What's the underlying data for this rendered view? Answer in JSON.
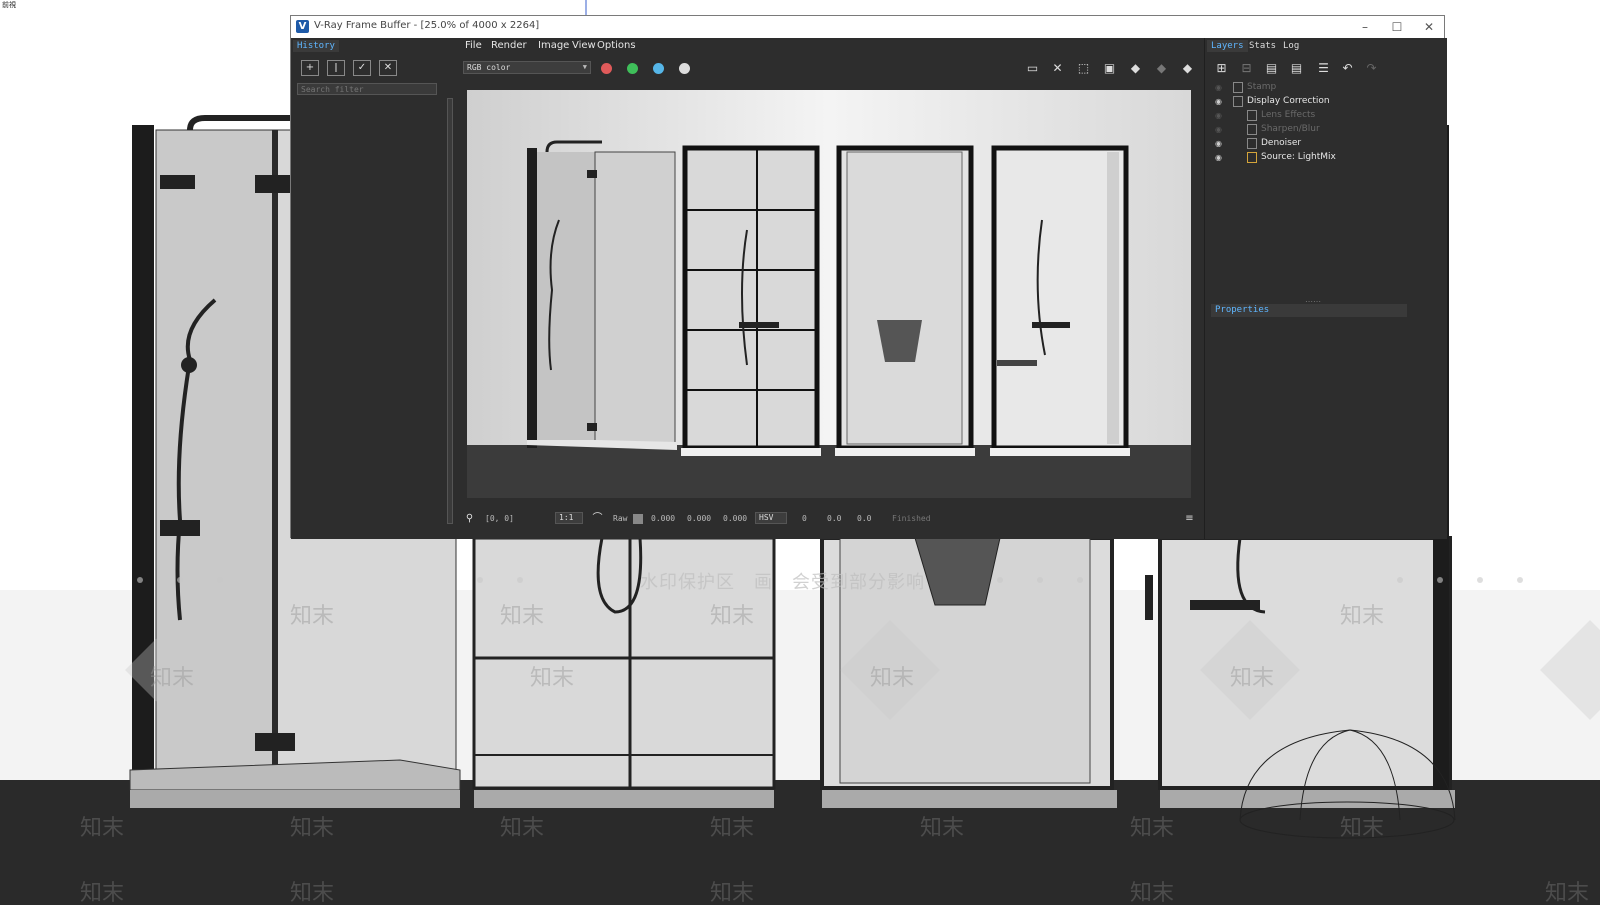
{
  "viewport": {
    "corner_label": "前視",
    "watermark_banner": "水印保护区　画　会受到部分影响",
    "watermark_text": "知末"
  },
  "window": {
    "title": "V-Ray Frame Buffer - [25.0% of 4000 x 2264]",
    "controls": {
      "minimize": "–",
      "maximize": "☐",
      "close": "✕"
    }
  },
  "history": {
    "tab": "History",
    "search_placeholder": "Search filter",
    "tools": [
      "save-to-history-icon",
      "ab-compare-icon",
      "load-history-icon",
      "remove-history-icon"
    ]
  },
  "menu": [
    "File",
    "Render",
    "Image",
    "View",
    "Options"
  ],
  "toolbar": {
    "channel": "RGB color",
    "colors": {
      "red": "#e05a5a",
      "green": "#3fbf5a",
      "blue": "#56b6e8"
    }
  },
  "status": {
    "coords": "[0, 0]",
    "zoom": "1:1",
    "raw_label": "Raw",
    "values": [
      "0.000",
      "0.000",
      "0.000"
    ],
    "mode": "HSV",
    "hsv_values": [
      "0",
      "0.0",
      "0.0"
    ],
    "state": "Finished"
  },
  "right_panel": {
    "tabs": [
      "Layers",
      "Stats",
      "Log"
    ],
    "layers": [
      {
        "name": "Stamp",
        "enabled": false,
        "indent": 0
      },
      {
        "name": "Display Correction",
        "enabled": true,
        "indent": 0
      },
      {
        "name": "Lens Effects",
        "enabled": false,
        "indent": 1
      },
      {
        "name": "Sharpen/Blur",
        "enabled": false,
        "indent": 1
      },
      {
        "name": "Denoiser",
        "enabled": true,
        "indent": 1
      },
      {
        "name": "Source: LightMix",
        "enabled": true,
        "indent": 1
      }
    ],
    "properties_label": "Properties"
  }
}
